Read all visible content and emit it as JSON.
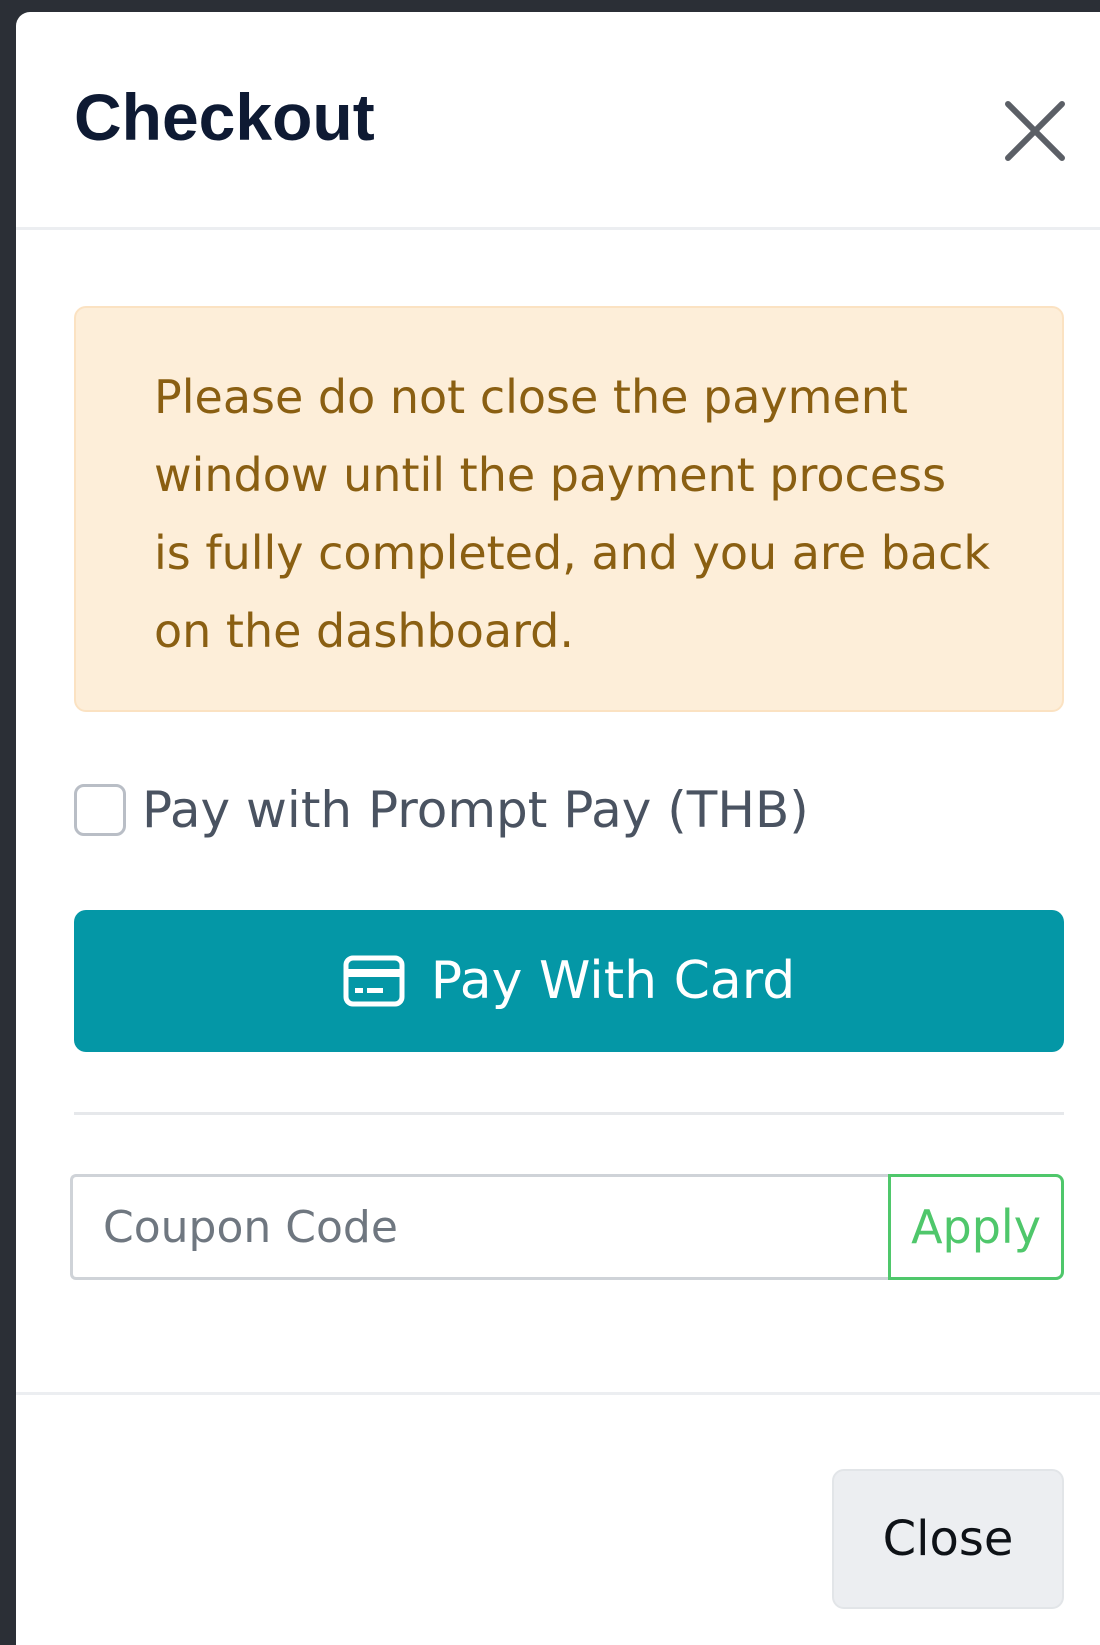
{
  "modal": {
    "title": "Checkout",
    "alert_text": "Please do not close the payment window until the payment process is fully completed, and you are back on the dashboard.",
    "prompt_pay": {
      "label": "Pay with Prompt Pay (THB)",
      "checked": false
    },
    "pay_button": {
      "label": "Pay With Card",
      "icon": "credit-card-icon"
    },
    "coupon": {
      "placeholder": "Coupon Code",
      "value": "",
      "apply_label": "Apply"
    },
    "footer": {
      "close_label": "Close"
    },
    "header_close_icon": "close-icon"
  },
  "colors": {
    "title": "#0e1a33",
    "alert_bg": "#fdeed9",
    "alert_text": "#8a5f12",
    "pay_button_bg": "#0497a6",
    "apply_green": "#4fc76b",
    "close_button_bg": "#eceef1"
  }
}
